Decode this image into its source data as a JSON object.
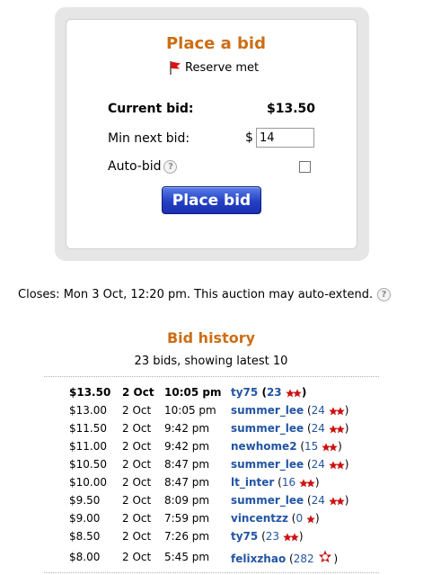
{
  "bid_panel": {
    "title": "Place a bid",
    "reserve_text": "Reserve met",
    "current_bid_label": "Current bid:",
    "current_bid_value": "$13.50",
    "min_next_bid_label": "Min next bid:",
    "currency_symbol": "$",
    "min_next_bid_value": "14",
    "auto_bid_label": "Auto-bid",
    "auto_bid_checked": false,
    "place_bid_label": "Place bid",
    "help_glyph": "?"
  },
  "closes_text": "Closes: Mon 3 Oct, 12:20 pm. This auction may auto-extend.",
  "history": {
    "title": "Bid history",
    "subtitle": "23 bids, showing latest 10",
    "rows": [
      {
        "amount": "$13.50",
        "date": "2 Oct",
        "time": "10:05 pm",
        "bidder": "ty75",
        "score": "23",
        "rating_icon": "two-star-icon",
        "top": true
      },
      {
        "amount": "$13.00",
        "date": "2 Oct",
        "time": "10:05 pm",
        "bidder": "summer_lee",
        "score": "24",
        "rating_icon": "two-star-icon",
        "top": false
      },
      {
        "amount": "$11.50",
        "date": "2 Oct",
        "time": "9:42 pm",
        "bidder": "summer_lee",
        "score": "24",
        "rating_icon": "two-star-icon",
        "top": false
      },
      {
        "amount": "$11.00",
        "date": "2 Oct",
        "time": "9:42 pm",
        "bidder": "newhome2",
        "score": "15",
        "rating_icon": "two-star-icon",
        "top": false
      },
      {
        "amount": "$10.50",
        "date": "2 Oct",
        "time": "8:47 pm",
        "bidder": "summer_lee",
        "score": "24",
        "rating_icon": "two-star-icon",
        "top": false
      },
      {
        "amount": "$10.00",
        "date": "2 Oct",
        "time": "8:47 pm",
        "bidder": "lt_inter",
        "score": "16",
        "rating_icon": "two-star-icon",
        "top": false
      },
      {
        "amount": "$9.50",
        "date": "2 Oct",
        "time": "8:09 pm",
        "bidder": "summer_lee",
        "score": "24",
        "rating_icon": "two-star-icon",
        "top": false
      },
      {
        "amount": "$9.00",
        "date": "2 Oct",
        "time": "7:59 pm",
        "bidder": "vincentzz",
        "score": "0",
        "rating_icon": "one-star-icon",
        "top": false
      },
      {
        "amount": "$8.50",
        "date": "2 Oct",
        "time": "7:26 pm",
        "bidder": "ty75",
        "score": "23",
        "rating_icon": "two-star-icon",
        "top": false
      },
      {
        "amount": "$8.00",
        "date": "2 Oct",
        "time": "5:45 pm",
        "bidder": "felixzhao",
        "score": "282",
        "rating_icon": "rosette-icon",
        "top": false
      }
    ]
  },
  "colors": {
    "heading": "#cc6e14",
    "link": "#2255a4",
    "star": "#cc1111",
    "button": "#2440c4"
  }
}
